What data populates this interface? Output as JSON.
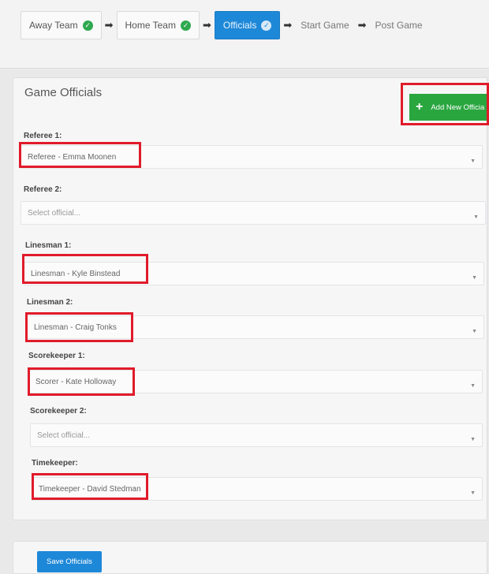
{
  "wizard": {
    "steps": [
      {
        "label": "Away Team",
        "done": true
      },
      {
        "label": "Home Team",
        "done": true
      },
      {
        "label": "Officials",
        "done": false,
        "active": true
      },
      {
        "label": "Start Game",
        "done": false
      },
      {
        "label": "Post Game",
        "done": false
      }
    ],
    "arrow": "➡"
  },
  "panel": {
    "title": "Game Officials",
    "add_button_label": "Add New Officia",
    "add_button_icon": "plus-icon"
  },
  "fields": [
    {
      "label": "Referee 1:",
      "value": "Referee - Emma Moonen"
    },
    {
      "label": "Referee 2:",
      "value": "Select official..."
    },
    {
      "label": "Linesman 1:",
      "value": "Linesman - Kyle Binstead"
    },
    {
      "label": "Linesman 2:",
      "value": "Linesman - Craig Tonks"
    },
    {
      "label": "Scorekeeper 1:",
      "value": "Scorer - Kate Holloway"
    },
    {
      "label": "Scorekeeper 2:",
      "value": "Select official..."
    },
    {
      "label": "Timekeeper:",
      "value": "Timekeeper - David Stedman"
    }
  ],
  "footer": {
    "save_label": "Save Officials"
  },
  "colors": {
    "primary": "#1e88d8",
    "success": "#2aa63f",
    "highlight": "#e01b2a"
  }
}
